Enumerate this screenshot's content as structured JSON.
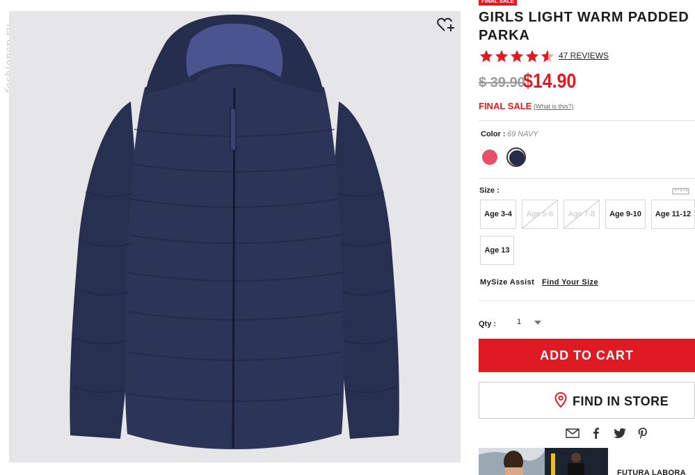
{
  "watermark": "fashionsp.ru",
  "product": {
    "sale_tag": "FINAL SALE",
    "title": "GIRLS LIGHT WARM PADDED PARKA",
    "rating": 4.5,
    "reviews_label": "47 REVIEWS",
    "price_old": "$ 39.90",
    "price_new": "$14.90",
    "final_sale": "FINAL SALE",
    "what_is_this": "(What is this?)"
  },
  "color": {
    "label": "Color :",
    "selected": "69 NAVY",
    "swatches": [
      {
        "name": "pink",
        "hex": "#e8506a",
        "selected": false
      },
      {
        "name": "navy",
        "hex": "#252c48",
        "selected": true
      }
    ]
  },
  "size": {
    "label": "Size :",
    "options": [
      {
        "label": "Age 3-4",
        "available": true
      },
      {
        "label": "Age 5-6",
        "available": false
      },
      {
        "label": "Age 7-8",
        "available": false
      },
      {
        "label": "Age 9-10",
        "available": true
      },
      {
        "label": "Age 11-12",
        "available": true
      },
      {
        "label": "Age 13",
        "available": true
      }
    ]
  },
  "mysize": {
    "label": "MySize Assist",
    "link": "Find Your Size"
  },
  "qty": {
    "label": "Qty :",
    "value": "1"
  },
  "actions": {
    "add_to_cart": "ADD TO CART",
    "find_in_store": "FIND IN STORE"
  },
  "share_icons": [
    "mail-icon",
    "facebook-icon",
    "twitter-icon",
    "pinterest-icon"
  ],
  "banner": {
    "text": "FUTURA LABORA"
  },
  "colors": {
    "accent": "#e01a22",
    "jacket": "#2a3255",
    "image_bg": "#e6e6e8"
  }
}
